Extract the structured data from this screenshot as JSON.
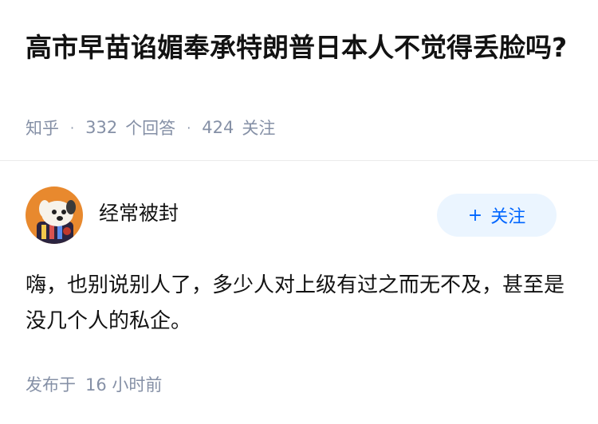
{
  "question": {
    "title": "高市早苗谄媚奉承特朗普日本人不觉得丢脸吗?",
    "meta": {
      "source": "知乎",
      "separator": "·",
      "answer_count": "332",
      "answer_label": "个回答",
      "follower_count": "424",
      "follower_label": "关注"
    }
  },
  "answer": {
    "author": {
      "name": "经常被封",
      "avatar_icon": "cartoon-dog-avatar-icon"
    },
    "follow_button": {
      "icon": "+",
      "label": "关注"
    },
    "content": "嗨，也别说别人了，多少人对上级有过之而无不及，甚至是没几个人的私企。",
    "publish": {
      "label": "发布于",
      "time": "16 小时前"
    }
  },
  "colors": {
    "title": "#121212",
    "meta": "#8590a6",
    "accent": "#0066ff",
    "follow_bg": "#ebf5ff",
    "avatar_bg": "#e8892e"
  }
}
